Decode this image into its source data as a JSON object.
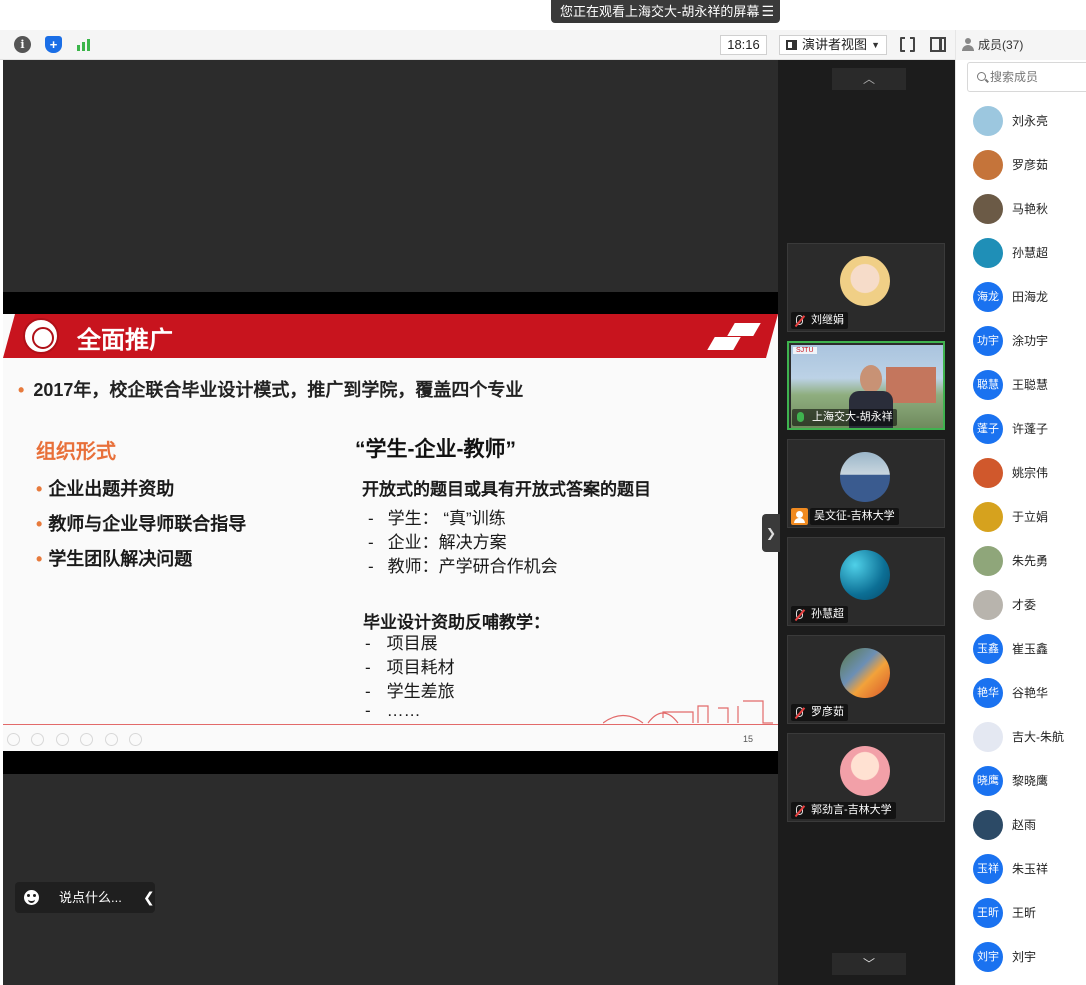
{
  "banner": {
    "viewing_text": "您正在观看上海交大-胡永祥的屏幕"
  },
  "toolbar": {
    "time": "18:16",
    "view_mode": "演讲者视图"
  },
  "slide": {
    "title": "全面推广",
    "headline": "2017年，校企联合毕业设计模式，推广到学院，覆盖四个专业",
    "section_label": "组织形式",
    "left_items": [
      "企业出题并资助",
      "教师与企业导师联合指导",
      "学生团队解决问题"
    ],
    "quote": "“学生-企业-教师”",
    "subhead": "开放式的题目或具有开放式答案的题目",
    "role_items": [
      "学生：  “真”训练",
      "企业：解决方案",
      "教师：产学研合作机会"
    ],
    "subhead2": "毕业设计资助反哺教学：",
    "support_items": [
      "项目展",
      "项目耗材",
      "学生差旅",
      "……"
    ],
    "page_number": "15"
  },
  "chat": {
    "placeholder": "说点什么..."
  },
  "video_tiles": [
    {
      "name": "刘继娟",
      "mic": "muted"
    },
    {
      "name": "上海交大-胡永祥",
      "mic": "speaking",
      "video": "开 on"
    },
    {
      "name": "吴文征-吉林大学",
      "mic": "muted"
    },
    {
      "name": "孙慧超",
      "mic": "muted"
    },
    {
      "name": "罗彦茹",
      "mic": "muted"
    },
    {
      "name": "郭劲言-吉林大学",
      "mic": "muted"
    }
  ],
  "members": {
    "header": "成员(37)",
    "search_placeholder": "搜索成员",
    "list": [
      {
        "name": "刘永亮",
        "avatar_text": "",
        "color": "#9cc7df"
      },
      {
        "name": "罗彦茹",
        "avatar_text": "",
        "color": "#c5743a"
      },
      {
        "name": "马艳秋",
        "avatar_text": "",
        "color": "#6b5a46"
      },
      {
        "name": "孙慧超",
        "avatar_text": "",
        "color": "#1f8fb7"
      },
      {
        "name": "田海龙",
        "avatar_text": "海龙",
        "color": "#1a72f0"
      },
      {
        "name": "涂功宇",
        "avatar_text": "功宇",
        "color": "#1a72f0"
      },
      {
        "name": "王聪慧",
        "avatar_text": "聪慧",
        "color": "#1a72f0"
      },
      {
        "name": "许蓬子",
        "avatar_text": "蓬子",
        "color": "#1a72f0"
      },
      {
        "name": "姚宗伟",
        "avatar_text": "",
        "color": "#d0582c"
      },
      {
        "name": "于立娟",
        "avatar_text": "",
        "color": "#d6a21e"
      },
      {
        "name": "朱先勇",
        "avatar_text": "",
        "color": "#8fa67a"
      },
      {
        "name": "才委",
        "avatar_text": "",
        "color": "#b8b4ad"
      },
      {
        "name": "崔玉鑫",
        "avatar_text": "玉鑫",
        "color": "#1a72f0"
      },
      {
        "name": "谷艳华",
        "avatar_text": "艳华",
        "color": "#1a72f0"
      },
      {
        "name": "吉大-朱航",
        "avatar_text": "",
        "color": "#e4e8f2"
      },
      {
        "name": "黎晓鹰",
        "avatar_text": "晓鹰",
        "color": "#1a72f0"
      },
      {
        "name": "赵雨",
        "avatar_text": "",
        "color": "#2c4a66"
      },
      {
        "name": "朱玉祥",
        "avatar_text": "玉祥",
        "color": "#1a72f0"
      },
      {
        "name": "王昕",
        "avatar_text": "王昕",
        "color": "#1a72f0"
      },
      {
        "name": "刘宇",
        "avatar_text": "刘宇",
        "color": "#1a72f0"
      }
    ]
  },
  "colors": {
    "brand_red": "#c8141e",
    "accent_orange": "#e8703a",
    "active_green": "#3fb34f",
    "avatar_blue": "#1a72f0"
  }
}
